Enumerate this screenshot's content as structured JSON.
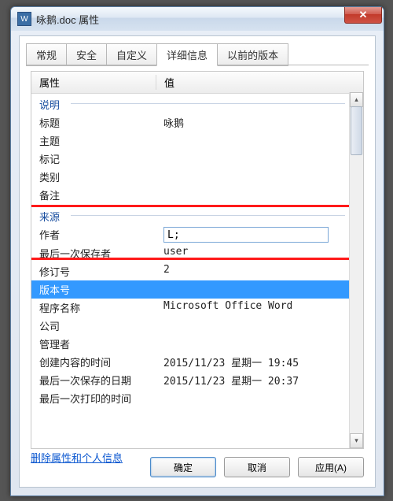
{
  "title": "咏鹅.doc 属性",
  "close_glyph": "✕",
  "tabs": [
    {
      "label": "常规"
    },
    {
      "label": "安全"
    },
    {
      "label": "自定义"
    },
    {
      "label": "详细信息",
      "active": true
    },
    {
      "label": "以前的版本"
    }
  ],
  "columns": {
    "property": "属性",
    "value": "值"
  },
  "sections": {
    "desc": {
      "title": "说明",
      "rows": [
        {
          "k": "标题",
          "v": "咏鹅"
        },
        {
          "k": "主题",
          "v": ""
        },
        {
          "k": "标记",
          "v": ""
        },
        {
          "k": "类别",
          "v": ""
        },
        {
          "k": "备注",
          "v": ""
        }
      ]
    },
    "origin": {
      "title": "来源",
      "rows": [
        {
          "k": "作者",
          "v": "L;",
          "editing": true
        },
        {
          "k": "最后一次保存者",
          "v": "user"
        },
        {
          "k": "修订号",
          "v": "2"
        },
        {
          "k": "版本号",
          "v": "",
          "selected": true
        },
        {
          "k": "程序名称",
          "v": "Microsoft Office Word"
        },
        {
          "k": "公司",
          "v": ""
        },
        {
          "k": "管理者",
          "v": ""
        },
        {
          "k": "创建内容的时间",
          "v": "2015/11/23 星期一 19:45"
        },
        {
          "k": "最后一次保存的日期",
          "v": "2015/11/23 星期一 20:37"
        },
        {
          "k": "最后一次打印的时间",
          "v": ""
        }
      ]
    }
  },
  "link": "删除属性和个人信息",
  "buttons": {
    "ok": "确定",
    "cancel": "取消",
    "apply": "应用(A)"
  },
  "scroll": {
    "up": "▴",
    "down": "▾"
  }
}
